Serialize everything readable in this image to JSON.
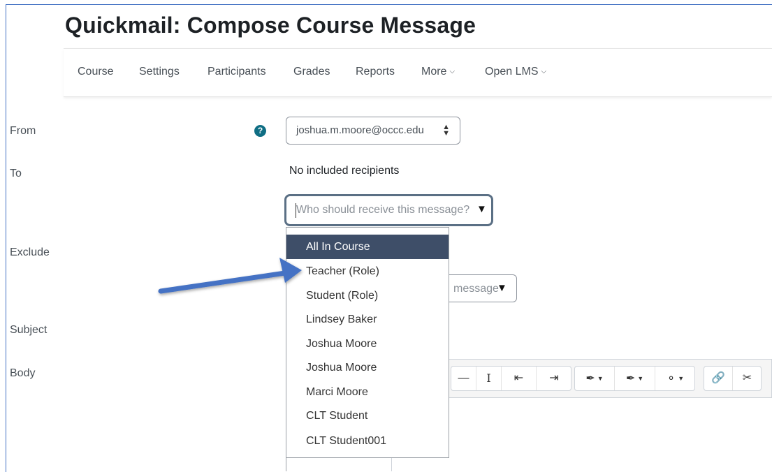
{
  "page": {
    "title": "Quickmail: Compose Course Message"
  },
  "nav": {
    "items": [
      {
        "label": "Course"
      },
      {
        "label": "Settings"
      },
      {
        "label": "Participants"
      },
      {
        "label": "Grades"
      },
      {
        "label": "Reports"
      },
      {
        "label": "More"
      },
      {
        "label": "Open LMS"
      }
    ]
  },
  "form": {
    "labels": {
      "from": "From",
      "to": "To",
      "exclude": "Exclude",
      "subject": "Subject",
      "body": "Body"
    },
    "from_value": "joshua.m.moore@occc.edu",
    "to_status": "No included recipients",
    "recipients_placeholder": "Who should receive this message?",
    "exclude_placeholder_visible": "message"
  },
  "dropdown": {
    "options": [
      {
        "label": "All In Course",
        "highlighted": true
      },
      {
        "label": "Teacher (Role)",
        "highlighted": false
      },
      {
        "label": "Student (Role)",
        "highlighted": false
      },
      {
        "label": "Lindsey Baker",
        "highlighted": false
      },
      {
        "label": "Joshua Moore",
        "highlighted": false
      },
      {
        "label": "Joshua Moore",
        "highlighted": false
      },
      {
        "label": "Marci Moore",
        "highlighted": false
      },
      {
        "label": "CLT Student",
        "highlighted": false
      },
      {
        "label": "CLT Student001",
        "highlighted": false
      }
    ]
  },
  "toolbar": {
    "icons": [
      "horizontal-rule-icon",
      "text-cursor-icon",
      "outdent-icon",
      "indent-icon",
      "font-color-icon",
      "background-color-icon",
      "accessibility-icon",
      "link-icon",
      "unlink-icon"
    ]
  },
  "colors": {
    "highlight": "#3e4e68",
    "annotation_arrow": "#4472c4",
    "help_icon": "#0f6e84"
  }
}
